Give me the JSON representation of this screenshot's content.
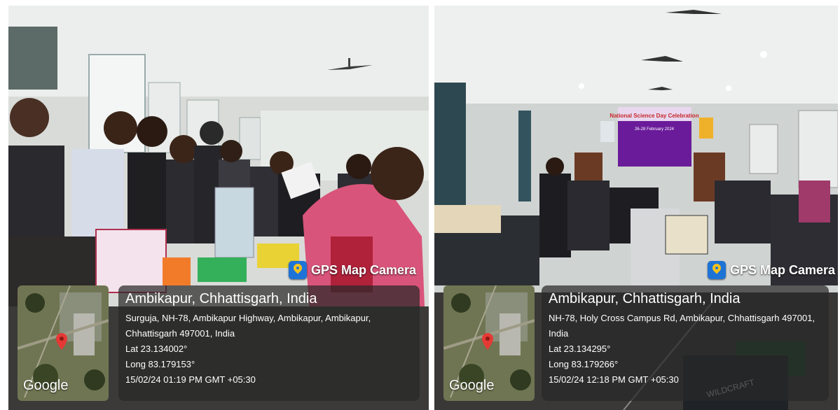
{
  "photos": [
    {
      "badge": "GPS Map Camera",
      "map_label": "Google",
      "city": "Ambikapur, Chhattisgarh, India",
      "address_line1": "Surguja, NH-78, Ambikapur Highway, Ambikapur, Ambikapur,",
      "address_line2": "Chhattisgarh 497001, India",
      "lat": "Lat 23.134002°",
      "long": "Long 83.179153°",
      "datetime": "15/02/24 01:19 PM GMT +05:30"
    },
    {
      "badge": "GPS Map Camera",
      "map_label": "Google",
      "city": "Ambikapur, Chhattisgarh, India",
      "address_line1": "NH-78, Holy Cross Campus Rd, Ambikapur, Chhattisgarh 497001, India",
      "lat": "Lat 23.134295°",
      "long": "Long 83.179266°",
      "datetime": "15/02/24 12:18 PM GMT +05:30"
    }
  ],
  "banner": {
    "title": "National Science Day Celebration",
    "dates": "26-28 February 2024"
  },
  "colors": {
    "pin": "#e53935",
    "badge_icon": "#1e73d6",
    "banner_bg": "#6a1b9a",
    "overlay": "#282828"
  }
}
